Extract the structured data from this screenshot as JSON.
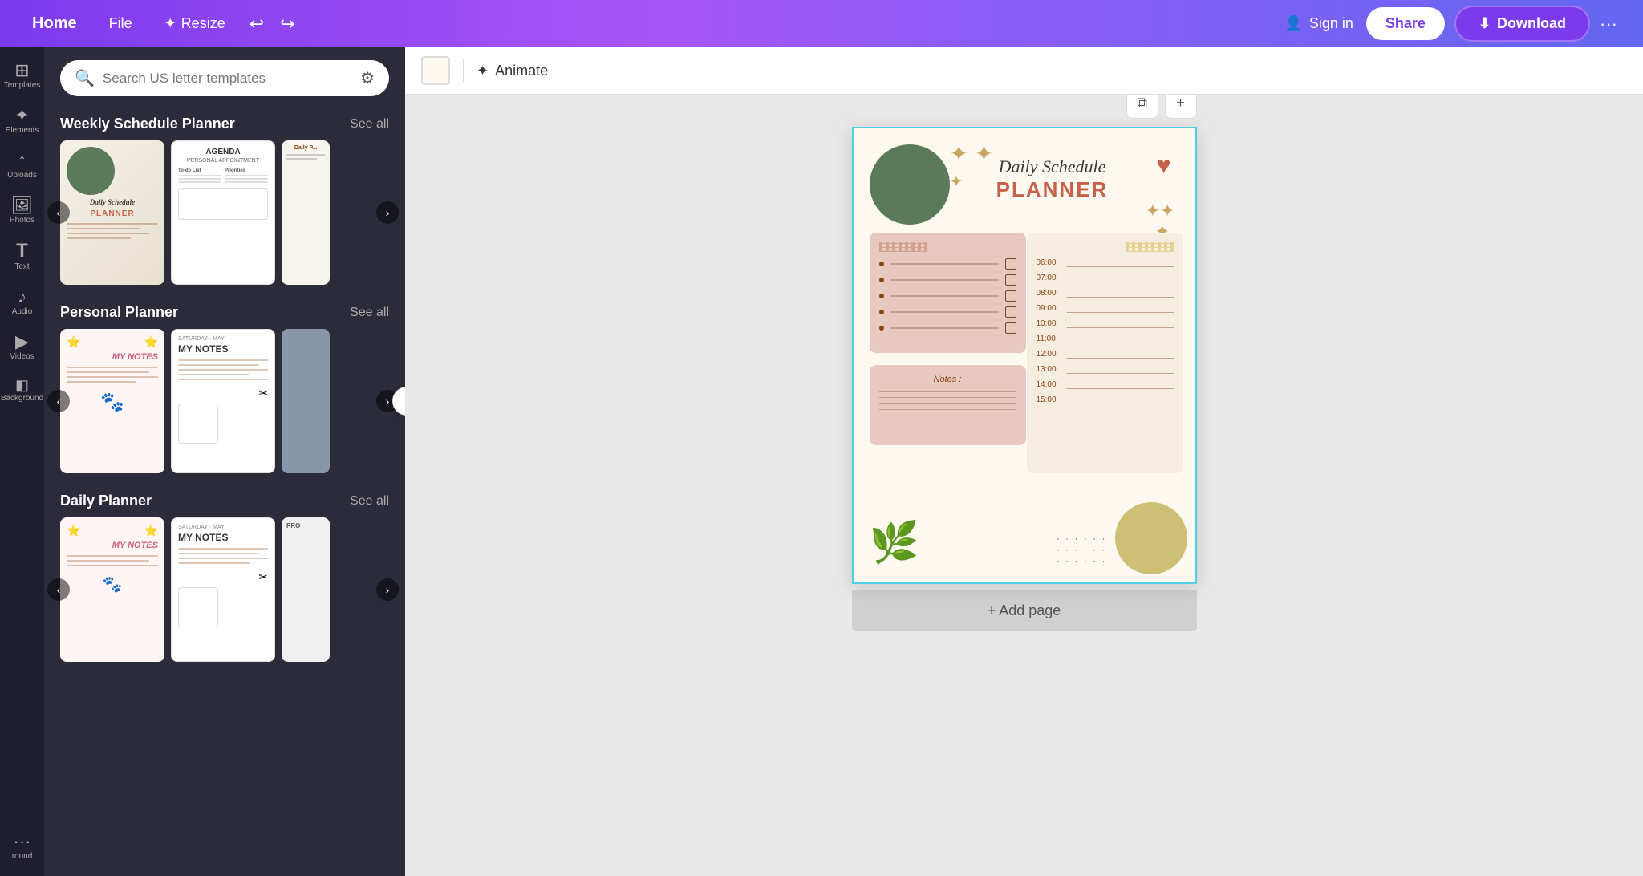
{
  "nav": {
    "home": "Home",
    "file": "File",
    "resize": "Resize",
    "sign_in": "Sign in",
    "share": "Share",
    "download": "Download",
    "more": "···"
  },
  "search": {
    "placeholder": "Search US letter templates"
  },
  "sections": [
    {
      "id": "weekly",
      "title": "Weekly Schedule Planner",
      "see_all": "See all"
    },
    {
      "id": "personal",
      "title": "Personal Planner",
      "see_all": "See all"
    },
    {
      "id": "daily",
      "title": "Daily Planner",
      "see_all": "See all"
    }
  ],
  "toolbar": {
    "animate": "Animate",
    "add_page": "+ Add page"
  },
  "sidebar_items": [
    {
      "id": "templates",
      "icon": "⊞",
      "label": "Templates"
    },
    {
      "id": "elements",
      "icon": "✦",
      "label": "Elements"
    },
    {
      "id": "uploads",
      "icon": "↑",
      "label": "Uploads"
    },
    {
      "id": "photos",
      "icon": "🖼",
      "label": "Photos"
    },
    {
      "id": "text",
      "icon": "T",
      "label": "Text"
    },
    {
      "id": "audio",
      "icon": "♪",
      "label": "Audio"
    },
    {
      "id": "videos",
      "icon": "▶",
      "label": "Videos"
    },
    {
      "id": "background",
      "icon": "◧",
      "label": "Background"
    },
    {
      "id": "round",
      "icon": "○",
      "label": "round"
    }
  ],
  "planner": {
    "subtitle": "Daily Schedule",
    "main_title": "PLANNER",
    "schedule_times": [
      "06:00",
      "07:00",
      "08:00",
      "09:00",
      "10:00",
      "11:00",
      "12:00",
      "13:00",
      "14:00",
      "15:00"
    ],
    "notes_label": "Notes :"
  },
  "colors": {
    "accent_purple": "#7c3aed",
    "nav_bg_start": "#7c3aed",
    "nav_bg_end": "#6366f1",
    "panel_bg": "#2b2b3a",
    "planner_bg": "#fdf8f0",
    "planner_accent": "#c8614a",
    "planner_green": "#5a7a5a"
  }
}
